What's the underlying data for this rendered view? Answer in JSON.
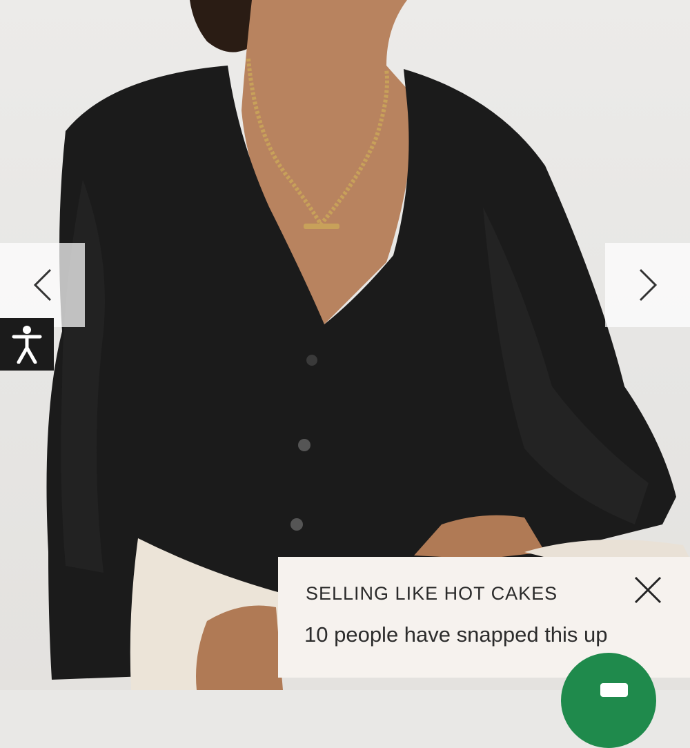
{
  "gallery": {
    "prev_icon": "chevron-left-icon",
    "next_icon": "chevron-right-icon"
  },
  "accessibility": {
    "icon": "accessibility-person-icon"
  },
  "toast": {
    "title": "SELLING LIKE HOT CAKES",
    "message": "10 people have snapped this up",
    "close_icon": "close-x-icon"
  },
  "chat": {
    "icon": "chat-bubble-icon",
    "color": "#1f8a4c"
  },
  "colors": {
    "sweater": "#1a1a1a",
    "skin": "#b8835f",
    "pants": "#ece4d8",
    "necklace": "#c8a15a"
  }
}
